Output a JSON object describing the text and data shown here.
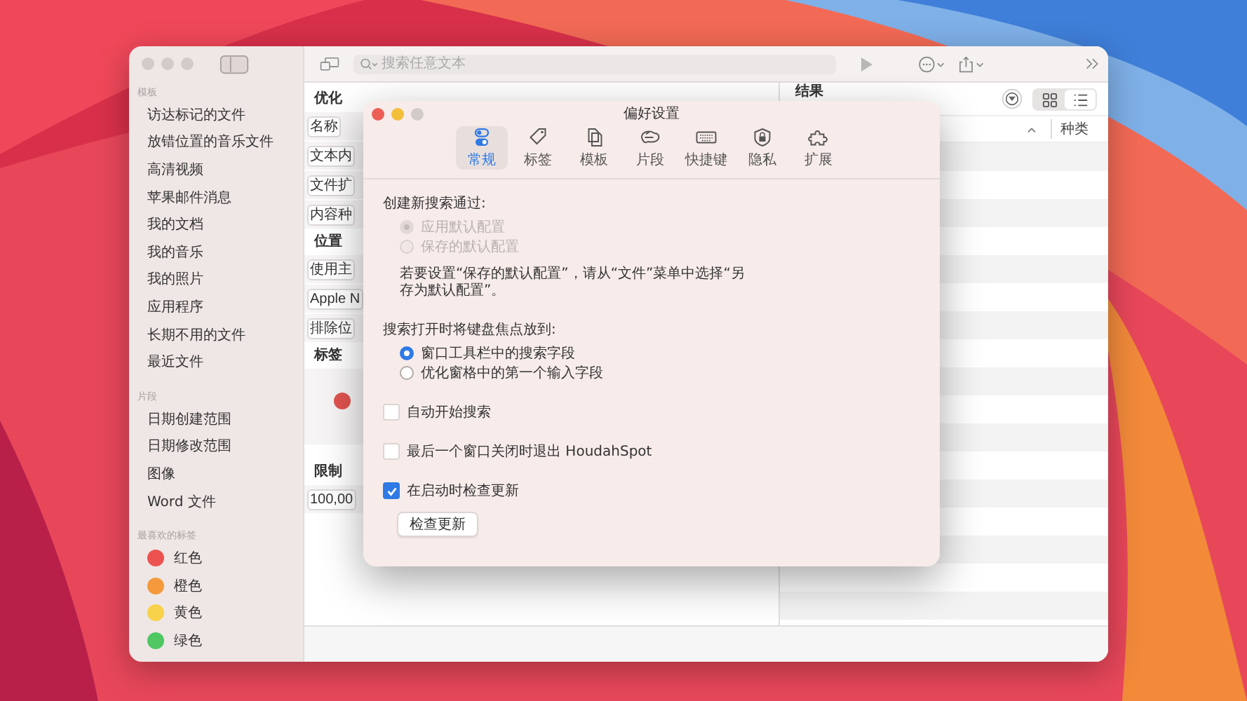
{
  "sidebar": {
    "sections": [
      {
        "title": "模板",
        "items": [
          {
            "label": "访达标记的文件",
            "selected": false
          },
          {
            "label": "放错位置的音乐文件",
            "selected": false
          },
          {
            "label": "高清视频",
            "selected": false
          },
          {
            "label": "苹果邮件消息",
            "selected": false
          },
          {
            "label": "我的文档",
            "selected": false
          },
          {
            "label": "我的音乐",
            "selected": false
          },
          {
            "label": "我的照片",
            "selected": false
          },
          {
            "label": "应用程序",
            "selected": false
          },
          {
            "label": "长期不用的文件",
            "selected": false
          },
          {
            "label": "最近文件",
            "selected": false
          }
        ]
      },
      {
        "title": "片段",
        "items": [
          {
            "label": "日期创建范围",
            "selected": false
          },
          {
            "label": "日期修改范围",
            "selected": false
          },
          {
            "label": "图像",
            "selected": false
          },
          {
            "label": "Word 文件",
            "selected": false
          }
        ]
      },
      {
        "title": "最喜欢的标签",
        "items": [
          {
            "label": "红色",
            "color": "#ec5350",
            "selected": false
          },
          {
            "label": "橙色",
            "color": "#f49a3c",
            "selected": false
          },
          {
            "label": "黄色",
            "color": "#f8d24a",
            "selected": false
          },
          {
            "label": "绿色",
            "color": "#4fc763",
            "selected": false
          }
        ]
      }
    ]
  },
  "toolbar": {
    "search_placeholder": "搜索任意文本"
  },
  "refine": {
    "sections": [
      {
        "title": "优化",
        "rows": [
          "名称",
          "文本内",
          "文件扩",
          "内容种"
        ]
      },
      {
        "title": "位置",
        "rows": [
          "使用主",
          "Apple N",
          "排除位"
        ]
      },
      {
        "title": "标签",
        "tags": [
          {
            "color": "#e0534f"
          }
        ]
      },
      {
        "title": "限制",
        "rows": [
          "100,00"
        ]
      }
    ]
  },
  "results": {
    "title": "结果",
    "columns": [
      {
        "label": "种类"
      }
    ],
    "view_modes": [
      {
        "kind": "grid",
        "selected": false
      },
      {
        "kind": "list",
        "selected": true
      }
    ]
  },
  "dialog": {
    "title": "偏好设置",
    "tabs": [
      {
        "label": "常规",
        "kind": "general",
        "selected": true
      },
      {
        "label": "标签",
        "kind": "tag",
        "selected": false
      },
      {
        "label": "模板",
        "kind": "template",
        "selected": false
      },
      {
        "label": "片段",
        "kind": "snippet",
        "selected": false
      },
      {
        "label": "快捷键",
        "kind": "keyboard",
        "selected": false
      },
      {
        "label": "隐私",
        "kind": "privacy",
        "selected": false
      },
      {
        "label": "扩展",
        "kind": "extension",
        "selected": false
      }
    ],
    "new_search": {
      "title": "创建新搜索通过:",
      "options": [
        {
          "label": "应用默认配置",
          "selected": true,
          "disabled": true
        },
        {
          "label": "保存的默认配置",
          "selected": false,
          "disabled": true
        }
      ],
      "note": "若要设置“保存的默认配置”，请从“文件”菜单中选择“另存为默认配置”。"
    },
    "focus": {
      "title": "搜索打开时将键盘焦点放到:",
      "options": [
        {
          "label": "窗口工具栏中的搜索字段",
          "selected": true,
          "disabled": false
        },
        {
          "label": "优化窗格中的第一个输入字段",
          "selected": false,
          "disabled": false
        }
      ]
    },
    "checkboxes": [
      {
        "label": "自动开始搜索",
        "checked": false
      },
      {
        "label": "最后一个窗口关闭时退出 HoudahSpot",
        "checked": false
      },
      {
        "label": "在启动时检查更新",
        "checked": true
      }
    ],
    "button": "检查更新"
  }
}
